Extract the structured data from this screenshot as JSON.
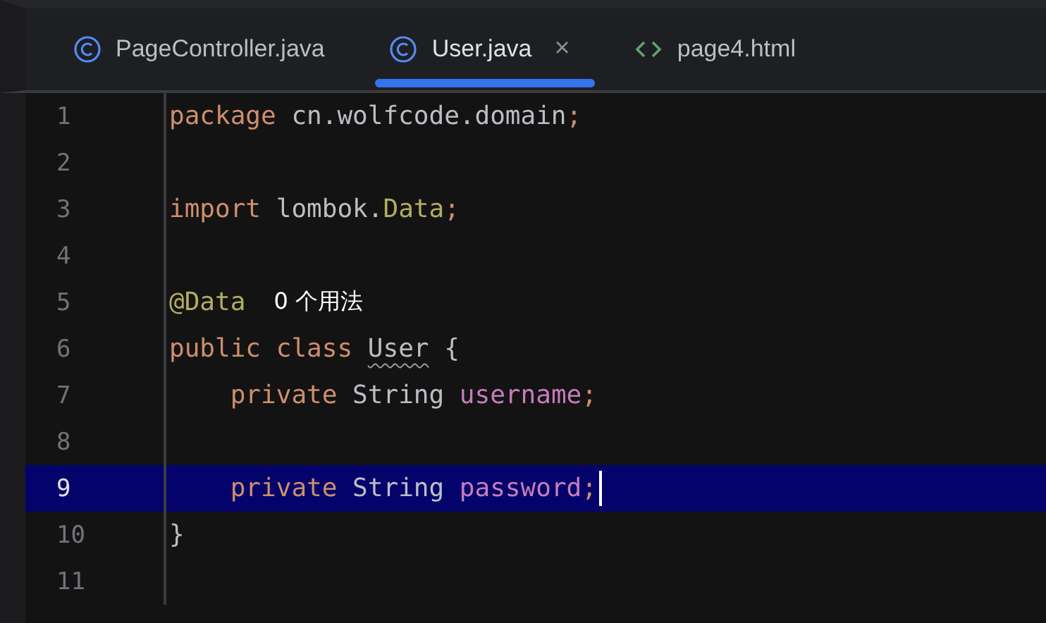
{
  "tabs": [
    {
      "label": "PageController.java",
      "kind": "class",
      "selected": false
    },
    {
      "label": "User.java",
      "kind": "class",
      "selected": true,
      "close": "×"
    },
    {
      "label": "page4.html",
      "kind": "html",
      "selected": false
    }
  ],
  "editor": {
    "lines": [
      {
        "number": "1",
        "current": false,
        "tokens": [
          {
            "text": "package",
            "kind": "keyword"
          },
          {
            "text": " cn.wolfcode.domain",
            "kind": "plain"
          },
          {
            "text": ";",
            "kind": "keyword"
          }
        ]
      },
      {
        "number": "2",
        "current": false
      },
      {
        "number": "3",
        "current": false,
        "tokens": [
          {
            "text": "import",
            "kind": "keyword"
          },
          {
            "text": " lombok.",
            "kind": "plain"
          },
          {
            "text": "Data",
            "kind": "annotation"
          },
          {
            "text": ";",
            "kind": "keyword"
          }
        ]
      },
      {
        "number": "4",
        "current": false
      },
      {
        "number": "5",
        "current": false,
        "tokens": [
          {
            "text": "@Data",
            "kind": "annotation"
          },
          {
            "text": "0 个用法",
            "kind": "hint"
          }
        ]
      },
      {
        "number": "6",
        "current": false,
        "tokens": [
          {
            "text": "public class ",
            "kind": "keyword"
          },
          {
            "text": "User",
            "kind": "warning"
          },
          {
            "text": " {",
            "kind": "plain"
          }
        ]
      },
      {
        "number": "7",
        "current": false,
        "tokens": [
          {
            "text": "    private",
            "kind": "keyword"
          },
          {
            "text": " String ",
            "kind": "plain"
          },
          {
            "text": "username",
            "kind": "field"
          },
          {
            "text": ";",
            "kind": "keyword"
          }
        ]
      },
      {
        "number": "8",
        "current": false
      },
      {
        "number": "9",
        "current": true,
        "caret": true,
        "tokens": [
          {
            "text": "    private",
            "kind": "keyword"
          },
          {
            "text": " String ",
            "kind": "plain"
          },
          {
            "text": "password",
            "kind": "field"
          },
          {
            "text": ";",
            "kind": "keyword"
          }
        ]
      },
      {
        "number": "10",
        "current": false,
        "tokens": [
          {
            "text": "}",
            "kind": "plain"
          }
        ]
      },
      {
        "number": "11",
        "current": false
      }
    ]
  }
}
